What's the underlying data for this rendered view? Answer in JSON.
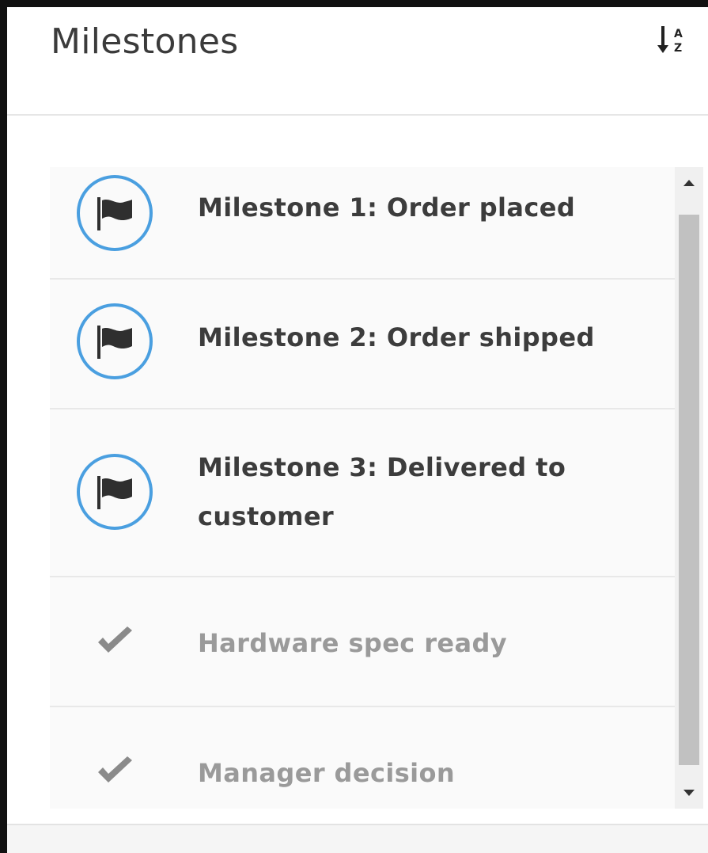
{
  "panel": {
    "title": "Milestones",
    "sort_icon": "sort-alpha-asc-icon"
  },
  "milestones": [
    {
      "label": "Milestone 1: Order placed",
      "status": "pending",
      "icon": "flag-icon"
    },
    {
      "label": "Milestone 2: Order shipped",
      "status": "pending",
      "icon": "flag-icon"
    },
    {
      "label": "Milestone 3: Delivered to customer",
      "status": "pending",
      "icon": "flag-icon"
    },
    {
      "label": "Hardware spec ready",
      "status": "completed",
      "icon": "check-icon"
    },
    {
      "label": "Manager decision",
      "status": "completed",
      "icon": "check-icon"
    }
  ],
  "colors": {
    "accent": "#4a9fe0",
    "active_text": "#3c3c3c",
    "done_text": "#9a9a9a"
  }
}
